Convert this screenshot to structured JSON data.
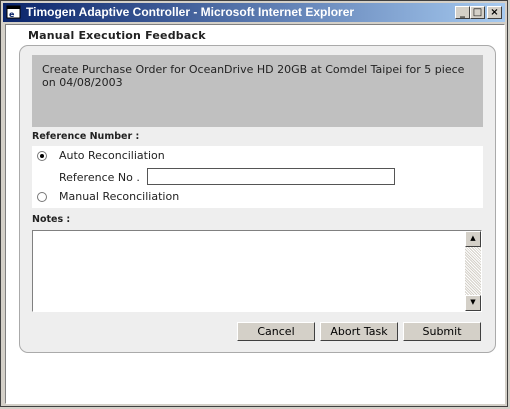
{
  "window": {
    "title": "Timogen Adaptive Controller - Microsoft Internet Explorer"
  },
  "titlebar_buttons": {
    "minimize": "_",
    "maximize": "□",
    "close": "×"
  },
  "page": {
    "heading": "Manual Execution Feedback",
    "description": "Create Purchase Order for OceanDrive HD 20GB at Comdel Taipei for 5 piece on 04/08/2003",
    "reference_label": "Reference Number :",
    "options": {
      "auto": "Auto Reconciliation",
      "reference_no_label": "Reference No .",
      "reference_no_value": "",
      "manual": "Manual Reconciliation",
      "selected": "auto"
    },
    "notes_label": "Notes :",
    "notes_value": "",
    "buttons": {
      "cancel": "Cancel",
      "abort": "Abort Task",
      "submit": "Submit"
    }
  },
  "icons": {
    "app": "ie-icon",
    "scroll_up": "up-arrow-icon",
    "scroll_down": "down-arrow-icon"
  }
}
